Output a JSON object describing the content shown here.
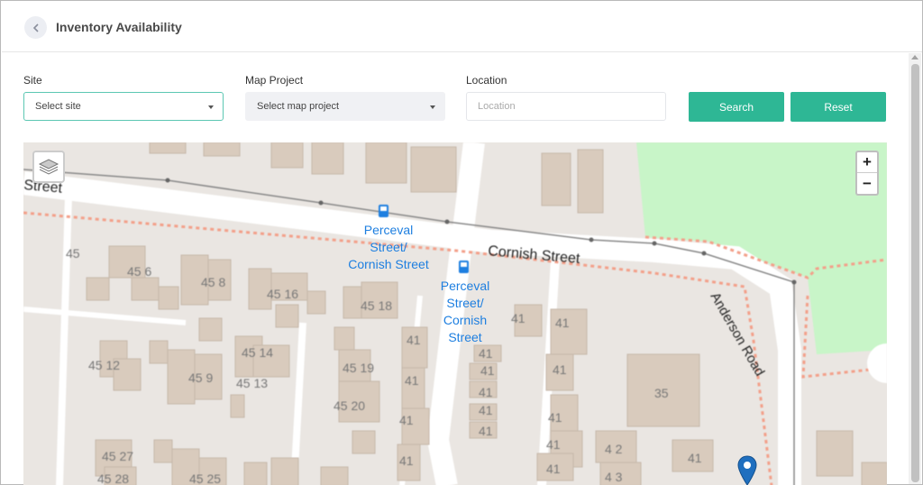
{
  "header": {
    "title": "Inventory Availability"
  },
  "filters": {
    "site": {
      "label": "Site",
      "value": "Select site"
    },
    "map_project": {
      "label": "Map Project",
      "value": "Select map project"
    },
    "location": {
      "label": "Location",
      "placeholder": "Location",
      "value": ""
    }
  },
  "actions": {
    "search_label": "Search",
    "reset_label": "Reset"
  },
  "map": {
    "zoom_in": "+",
    "zoom_out": "−",
    "streets": [
      "Cornish Street",
      "Anderson Road",
      "Street"
    ],
    "bus_stops": [
      "Perceval Street/ Cornish Street",
      "Perceval Street/ Cornish Street"
    ],
    "house_numbers": [
      "45",
      "45 6",
      "45 8",
      "45 16",
      "45 18",
      "45 12",
      "45 14",
      "45 9",
      "45 13",
      "45 19",
      "45 20",
      "45 27",
      "45 28",
      "45 25",
      "41",
      "41",
      "41",
      "41",
      "41",
      "41",
      "41",
      "41",
      "41",
      "41",
      "41",
      "41",
      "41",
      "41",
      "41",
      "41",
      "41",
      "41",
      "41",
      "4 2",
      "4 3",
      "35"
    ]
  },
  "colors": {
    "accent": "#2eb795",
    "park": "#c8f5c8",
    "bus": "#1e7fe0",
    "pin": "#1f6fbf"
  }
}
